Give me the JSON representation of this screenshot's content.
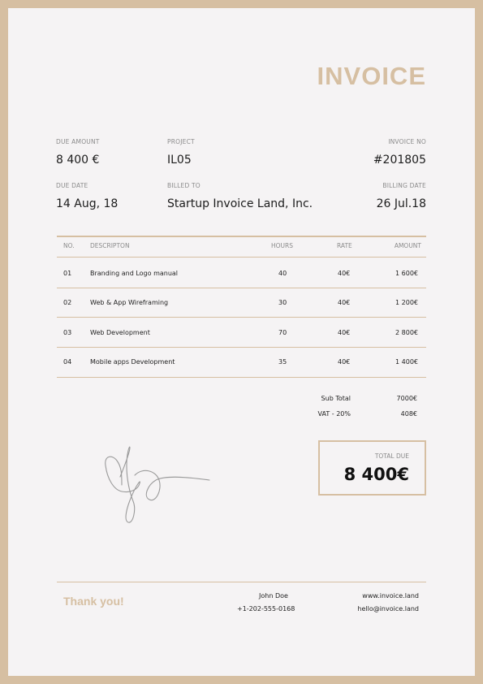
{
  "title": "INVOICE",
  "meta": {
    "due_amount_label": "DUE AMOUNT",
    "due_amount": "8 400 €",
    "project_label": "PROJECT",
    "project": "IL05",
    "invoice_no_label": "INVOICE NO",
    "invoice_no": "#201805",
    "due_date_label": "DUE DATE",
    "due_date": "14 Aug, 18",
    "billed_to_label": "BILLED TO",
    "billed_to": "Startup Invoice Land, Inc.",
    "billing_date_label": "BILLING DATE",
    "billing_date": "26 Jul.18"
  },
  "table": {
    "headers": {
      "no": "NO.",
      "description": "DESCRIPTON",
      "hours": "HOURS",
      "rate": "RATE",
      "amount": "AMOUNT"
    },
    "rows": [
      {
        "no": "01",
        "description": "Branding and Logo manual",
        "hours": "40",
        "rate": "40€",
        "amount": "1 600€"
      },
      {
        "no": "02",
        "description": "Web & App Wireframing",
        "hours": "30",
        "rate": "40€",
        "amount": "1 200€"
      },
      {
        "no": "03",
        "description": "Web Development",
        "hours": "70",
        "rate": "40€",
        "amount": "2 800€"
      },
      {
        "no": "04",
        "description": "Mobile apps Development",
        "hours": "35",
        "rate": "40€",
        "amount": "1 400€"
      }
    ]
  },
  "totals": {
    "subtotal_label": "Sub Total",
    "subtotal": "7000€",
    "vat_label": "VAT - 20%",
    "vat": "408€",
    "total_due_label": "TOTAL DUE",
    "total_due": "8 400€"
  },
  "footer": {
    "thanks": "Thank you!",
    "name": "John Doe",
    "phone": "+1-202-555-0168",
    "website": "www.invoice.land",
    "email": "hello@invoice.land"
  },
  "colors": {
    "accent": "#d6bfa2",
    "paper": "#f5f3f4"
  }
}
